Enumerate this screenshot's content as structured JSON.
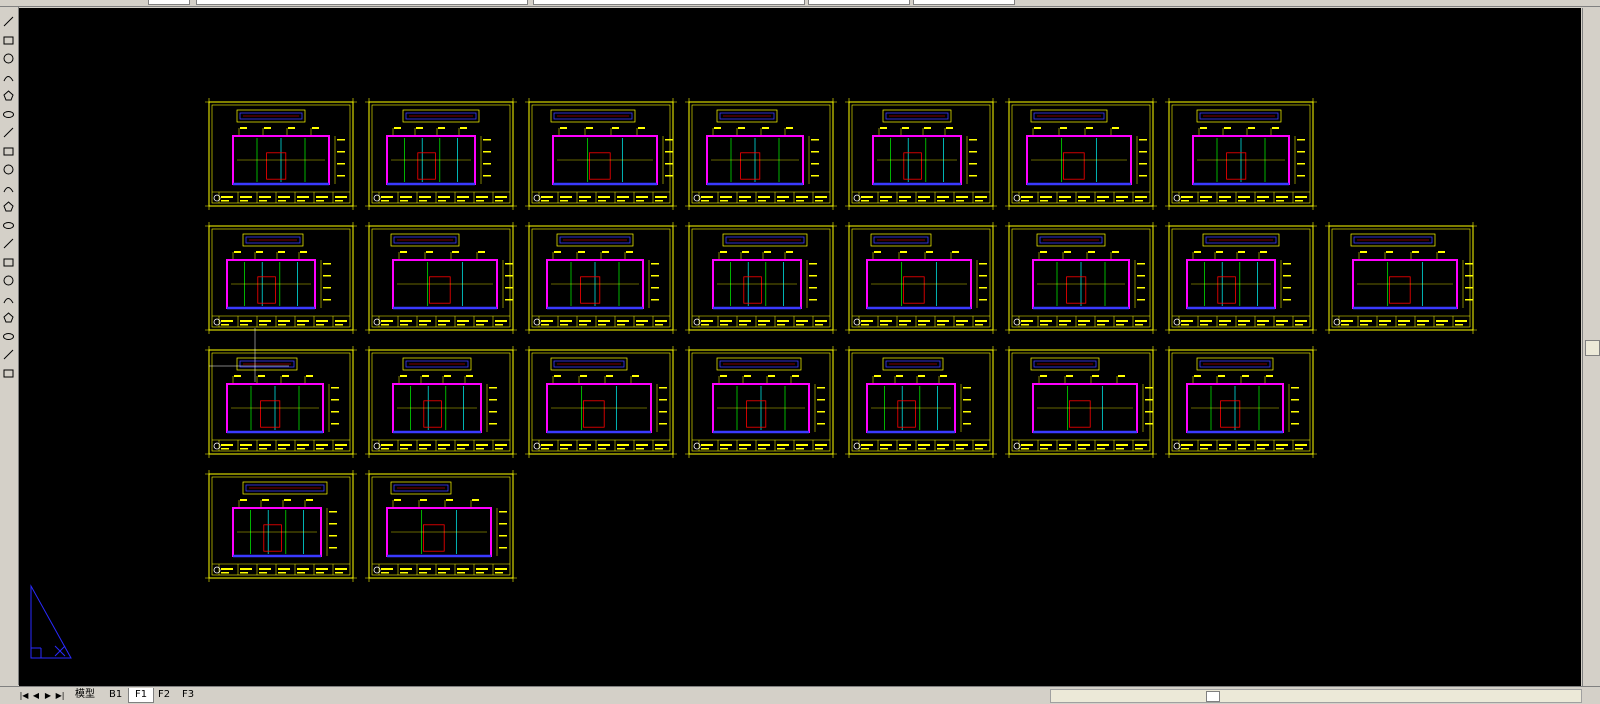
{
  "layout_tabs": [
    {
      "label": "模型",
      "active": false
    },
    {
      "label": "B1",
      "active": false
    },
    {
      "label": "F1",
      "active": true
    },
    {
      "label": "F2",
      "active": false
    },
    {
      "label": "F3",
      "active": false
    }
  ],
  "nav_buttons": [
    "first",
    "previous",
    "next",
    "last"
  ],
  "toolbar_icons": [
    "line-icon",
    "construction-line-icon",
    "polyline-icon",
    "polygon-icon",
    "rectangle-icon",
    "arc-icon",
    "circle-icon",
    "revision-cloud-icon",
    "spline-icon",
    "ellipse-icon",
    "ellipse-arc-icon",
    "insert-block-icon",
    "make-block-icon",
    "point-icon",
    "hatch-icon",
    "gradient-icon",
    "region-icon",
    "table-icon",
    "multiline-text-icon",
    "add-selected-icon"
  ],
  "sheet_rows": [
    7,
    8,
    7,
    2
  ],
  "colors": {
    "canvas": "#000000",
    "frame": "#ffff00",
    "wall": "#ff00ff",
    "detail_blue": "#3a3aff",
    "detail_green": "#00ff00",
    "detail_red": "#ff0000",
    "detail_cyan": "#00ffff",
    "ucs": "#2a2aff"
  }
}
